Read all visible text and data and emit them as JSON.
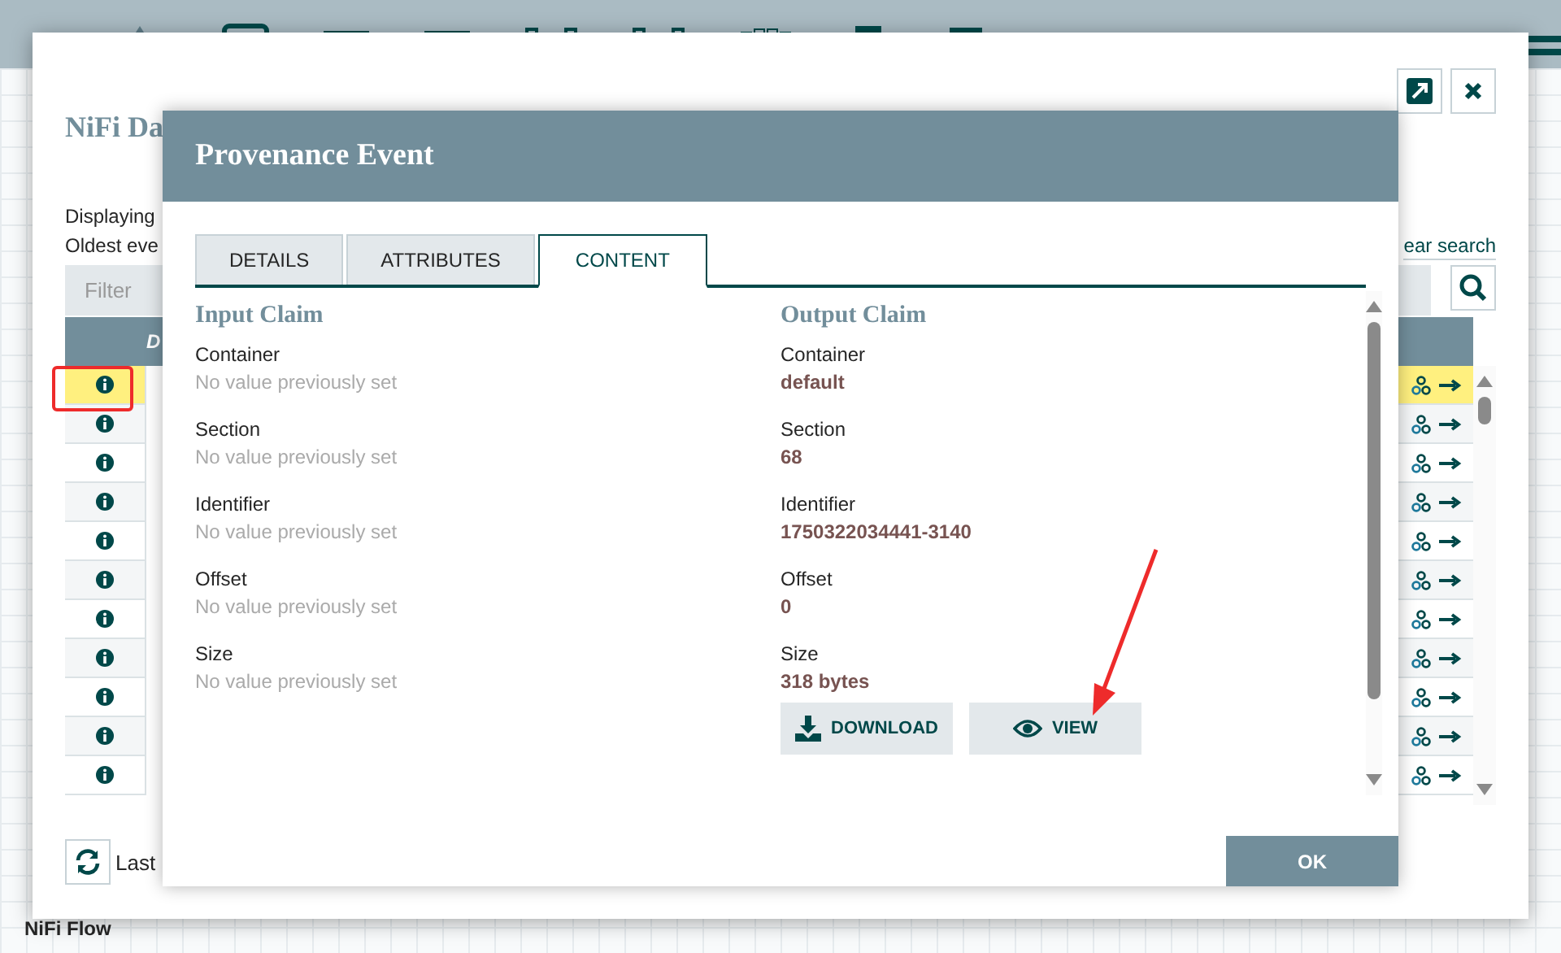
{
  "app": {
    "breadcrumb": "NiFi Flow"
  },
  "summary_dialog": {
    "title": "NiFi Da",
    "info_lines": [
      "Displaying",
      "Oldest eve"
    ],
    "clear_search": "ear search",
    "filter": {
      "placeholder": "Filter"
    },
    "table": {
      "header_text": "D",
      "rows": [
        {
          "selected": true
        },
        {
          "selected": false
        },
        {
          "selected": false
        },
        {
          "selected": false
        },
        {
          "selected": false
        },
        {
          "selected": false
        },
        {
          "selected": false
        },
        {
          "selected": false
        },
        {
          "selected": false
        },
        {
          "selected": false
        },
        {
          "selected": false
        }
      ]
    },
    "footer_label": "Last"
  },
  "provenance_dialog": {
    "title": "Provenance Event",
    "tabs": [
      {
        "label": "DETAILS",
        "selected": false
      },
      {
        "label": "ATTRIBUTES",
        "selected": false
      },
      {
        "label": "CONTENT",
        "selected": true
      }
    ],
    "claims": [
      {
        "heading": "Input Claim",
        "fields": [
          {
            "label": "Container",
            "value": "No value previously set",
            "kind": "empty"
          },
          {
            "label": "Section",
            "value": "No value previously set",
            "kind": "empty"
          },
          {
            "label": "Identifier",
            "value": "No value previously set",
            "kind": "empty"
          },
          {
            "label": "Offset",
            "value": "No value previously set",
            "kind": "empty"
          },
          {
            "label": "Size",
            "value": "No value previously set",
            "kind": "empty"
          }
        ]
      },
      {
        "heading": "Output Claim",
        "fields": [
          {
            "label": "Container",
            "value": "default",
            "kind": "set"
          },
          {
            "label": "Section",
            "value": "68",
            "kind": "set"
          },
          {
            "label": "Identifier",
            "value": "1750322034441-3140",
            "kind": "set"
          },
          {
            "label": "Offset",
            "value": "0",
            "kind": "set"
          },
          {
            "label": "Size",
            "value": "318 bytes",
            "kind": "set"
          }
        ],
        "buttons": [
          {
            "label": "DOWNLOAD",
            "kind": "download"
          },
          {
            "label": "VIEW",
            "kind": "view"
          }
        ]
      }
    ],
    "ok_button": "OK"
  },
  "annotations": {
    "highlight_box": {
      "color": "#ee2b2b"
    },
    "arrow": {
      "color": "#ee2b2b"
    }
  }
}
